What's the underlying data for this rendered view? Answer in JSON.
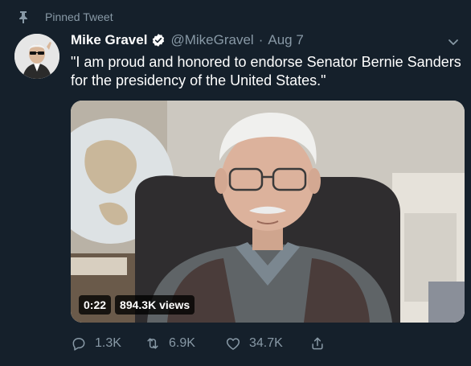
{
  "pinned_label": "Pinned Tweet",
  "author": {
    "name": "Mike Gravel",
    "handle": "@MikeGravel",
    "separator": "·",
    "date": "Aug 7"
  },
  "tweet_text": "\"I am proud and honored to endorse Senator Bernie Sanders for the presidency of the United States.\"",
  "video": {
    "duration": "0:22",
    "views": "894.3K views"
  },
  "stats": {
    "replies": "1.3K",
    "retweets": "6.9K",
    "likes": "34.7K"
  },
  "colors": {
    "background": "#15202b",
    "text_primary": "#ffffff",
    "text_secondary": "#8899a6",
    "verified": "#ffffff"
  },
  "icons": [
    "pin-icon",
    "verified-badge-icon",
    "chevron-down-icon",
    "reply-icon",
    "retweet-icon",
    "like-icon",
    "share-icon"
  ]
}
